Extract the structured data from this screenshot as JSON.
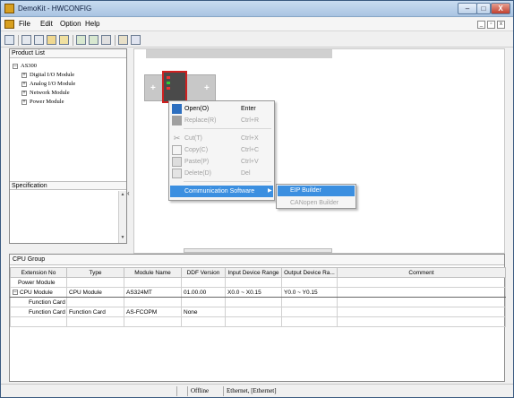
{
  "window": {
    "title": "DemoKit - HWCONFIG",
    "minimize": "–",
    "maximize": "□",
    "close": "X"
  },
  "menubar": {
    "items": [
      "File",
      "Edit",
      "Option",
      "Help"
    ]
  },
  "mdi_controls": [
    "_",
    "▫",
    "x"
  ],
  "toolbar": {
    "icons": [
      "save-icon",
      "cut-icon",
      "copy-icon",
      "paste-icon",
      "edit-icon",
      "upload-icon",
      "download-icon",
      "scan-icon",
      "settings-icon",
      "link-icon"
    ]
  },
  "product_list": {
    "header": "Product List",
    "root": "AS300",
    "items": [
      "Digital I/O Module",
      "Analog I/O Module",
      "Network Module",
      "Power Module"
    ]
  },
  "specification": {
    "header": "Specification"
  },
  "context_menu": {
    "items": [
      {
        "label": "Open(O)",
        "shortcut": "Enter",
        "enabled": true,
        "icon": "open-icon"
      },
      {
        "label": "Replace(R)",
        "shortcut": "Ctrl+R",
        "enabled": false,
        "icon": "replace-icon"
      },
      {
        "label": "Cut(T)",
        "shortcut": "Ctrl+X",
        "enabled": false,
        "icon": "cut-icon"
      },
      {
        "label": "Copy(C)",
        "shortcut": "Ctrl+C",
        "enabled": false,
        "icon": "copy-icon"
      },
      {
        "label": "Paste(P)",
        "shortcut": "Ctrl+V",
        "enabled": false,
        "icon": "paste-icon"
      },
      {
        "label": "Delete(D)",
        "shortcut": "Del",
        "enabled": false,
        "icon": "delete-icon"
      },
      {
        "label": "Communication Software",
        "shortcut": "",
        "enabled": true,
        "icon": "",
        "submenu": true
      }
    ],
    "submenu": [
      "EIP Builder",
      "CANopen Builder"
    ]
  },
  "cpu_group": {
    "title": "CPU Group",
    "columns": [
      "Extension No",
      "Type",
      "Module Name",
      "DDF Version",
      "Input Device Range",
      "Output Device Ra...",
      "Comment"
    ],
    "rows": [
      [
        "Power Module",
        "",
        "",
        "",
        "",
        "",
        ""
      ],
      [
        "CPU Module",
        "CPU Module",
        "AS324MT",
        "01.00.00",
        "X0.0 ~ X0.15",
        "Y0.0 ~ Y0.15",
        ""
      ],
      [
        "Function Card",
        "",
        "",
        "",
        "",
        "",
        ""
      ],
      [
        "Function Card",
        "Function Card",
        "AS-FCOPM",
        "None",
        "",
        "",
        ""
      ]
    ]
  },
  "statusbar": {
    "status": "Offline",
    "connection": "Ethernet, [Ethernet]"
  }
}
